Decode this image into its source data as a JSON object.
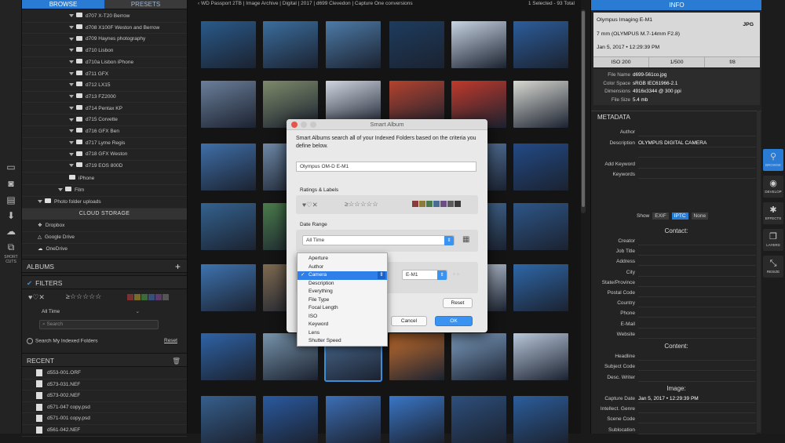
{
  "left_panel": {
    "tabs": [
      "BROWSE",
      "PRESETS"
    ],
    "folders": [
      "d707 X-T20 Berrow",
      "d708 X100F Weston and Berrow",
      "d709 Haynes photography",
      "d710 Lisbon",
      "d710a Lisbon iPhone",
      "d711 GFX",
      "d712 LX15",
      "d713 FZ2000",
      "d714 Pentax KP",
      "d715 Corvette",
      "d716 GFX Ben",
      "d717 Lyme Regis",
      "d718 GFX Weston",
      "d719 EOS 800D"
    ],
    "iphone": "iPhone",
    "film": "Film",
    "photo_uploads": "Photo folder uploads",
    "cloud_storage": "CLOUD STORAGE",
    "cloud": [
      "Dropbox",
      "Google Drive",
      "OneDrive"
    ],
    "albums": "ALBUMS",
    "albums_add": "+",
    "filters": "FILTERS",
    "rating_hearts": "♥♡✕",
    "rating_stars": "≥☆☆☆☆☆",
    "all_time": "All Time",
    "search_placeholder": "Search",
    "search_my_folders": "Search My Indexed Folders",
    "reset": "Reset",
    "recent": "RECENT",
    "recent_items": [
      "d553-001.ORF",
      "d573-031.NEF",
      "d573-002.NEF",
      "d571-047 copy.psd",
      "d571-001 copy.psd",
      "d561-042.NEF"
    ]
  },
  "tool_strip": {
    "shortcuts_label": "SHORT CUTS"
  },
  "breadcrumb": {
    "path": "WD Passport 2TB  |  Image Archive  |  Digital  |  2017  |  d699 Clevedon  |  Capture One conversions",
    "status": "1 Selected - 93 Total"
  },
  "thumb_colors": [
    [
      "#2a5a8a",
      "#3b6e9e",
      "#4d7ba8",
      "#1d3c5e",
      "#c8d4e2",
      "#2c5d9b"
    ],
    [
      "#6b7f9a",
      "#7d8a6a",
      "#cfd6e0",
      "#b4422e",
      "#c0392b",
      "#d9d9d2"
    ],
    [
      "#3f6fa8",
      "#6e88a6",
      "#2b4a73",
      "#d4c8b0",
      "#5b7ea8",
      "#224a86"
    ],
    [
      "#34628f",
      "#4a7c4a",
      "#e0e6ee",
      "#d6d2c8",
      "#47709c",
      "#2d5688"
    ],
    [
      "#3e73b0",
      "#806a50",
      "#d8dfe8",
      "#e6e6e6",
      "#c9d6e6",
      "#2e67a8"
    ],
    [
      "#2f63a6",
      "#7894ab",
      "#4c6c92",
      "#c66f2e",
      "#7d9dc0",
      "#b8c7da"
    ],
    [
      "#365f8c",
      "#2a5aa0",
      "#3c6fb6",
      "#3a76c6",
      "#2d4f7c",
      "#2c5e9c"
    ]
  ],
  "dialog": {
    "title": "Smart Album",
    "description": "Smart Albums search all of your Indexed Folders based on the criteria you define below.",
    "name_value": "Olympus OM-D E-M1",
    "ratings_labels": "Ratings & Labels",
    "hearts": "♥♡✕",
    "stars": "≥☆☆☆☆☆",
    "date_range": "Date Range",
    "date_value": "All Time",
    "criteria_value": "E-M1",
    "reset": "Reset",
    "cancel": "Cancel",
    "ok": "OK",
    "dropdown": [
      "Aperture",
      "Author",
      "Camera",
      "Description",
      "Everything",
      "File Type",
      "Focal Length",
      "ISO",
      "Keyword",
      "Lens",
      "Shutter Speed"
    ],
    "dropdown_selected": "Camera"
  },
  "right_panel": {
    "info_title": "INFO",
    "camera": "Olympus Imaging E-M1",
    "format": "JPG",
    "lens": "7 mm (OLYMPUS M.7-14mm F2.8)",
    "date": "Jan 5, 2017 • 12:29:39 PM",
    "exif": [
      "ISO 200",
      "1/500",
      "f/8"
    ],
    "file_info": [
      {
        "label": "File Name",
        "value": "d699-561co.jpg"
      },
      {
        "label": "Color Space",
        "value": "sRGB IEC61966-2.1"
      },
      {
        "label": "Dimensions",
        "value": "4916x3344 @ 300 ppi"
      },
      {
        "label": "File Size",
        "value": "5.4 mb"
      }
    ],
    "metadata_title": "METADATA",
    "meta_top": [
      {
        "label": "Author",
        "value": ""
      },
      {
        "label": "Description",
        "value": "OLYMPUS DIGITAL CAMERA"
      },
      {
        "label": "",
        "value": ""
      },
      {
        "label": "Add Keyword",
        "value": ""
      },
      {
        "label": "Keywords",
        "value": ""
      }
    ],
    "show": "Show",
    "show_tabs": [
      "EXIF",
      "IPTC",
      "None"
    ],
    "contact_title": "Contact:",
    "contact": [
      "Creator",
      "Job Title",
      "Address",
      "City",
      "State/Province",
      "Postal Code",
      "Country",
      "Phone",
      "E-Mail",
      "Website"
    ],
    "content_title": "Content:",
    "content": [
      "Headline",
      "Subject Code",
      "Desc. Writer"
    ],
    "image_title": "Image:",
    "image": [
      {
        "label": "Capture Date",
        "value": "Jan 5, 2017 • 12:29:39 PM"
      },
      {
        "label": "Intellect. Genre",
        "value": ""
      },
      {
        "label": "Scene Code",
        "value": ""
      },
      {
        "label": "Sublocation",
        "value": ""
      }
    ]
  },
  "right_strip": [
    {
      "icon": "⚲",
      "label": "BROWSE"
    },
    {
      "icon": "◉",
      "label": "DEVELOP"
    },
    {
      "icon": "✱",
      "label": "EFFECTS"
    },
    {
      "icon": "❐",
      "label": "LAYERS"
    },
    {
      "icon": "⤡",
      "label": "RESIZE"
    }
  ]
}
